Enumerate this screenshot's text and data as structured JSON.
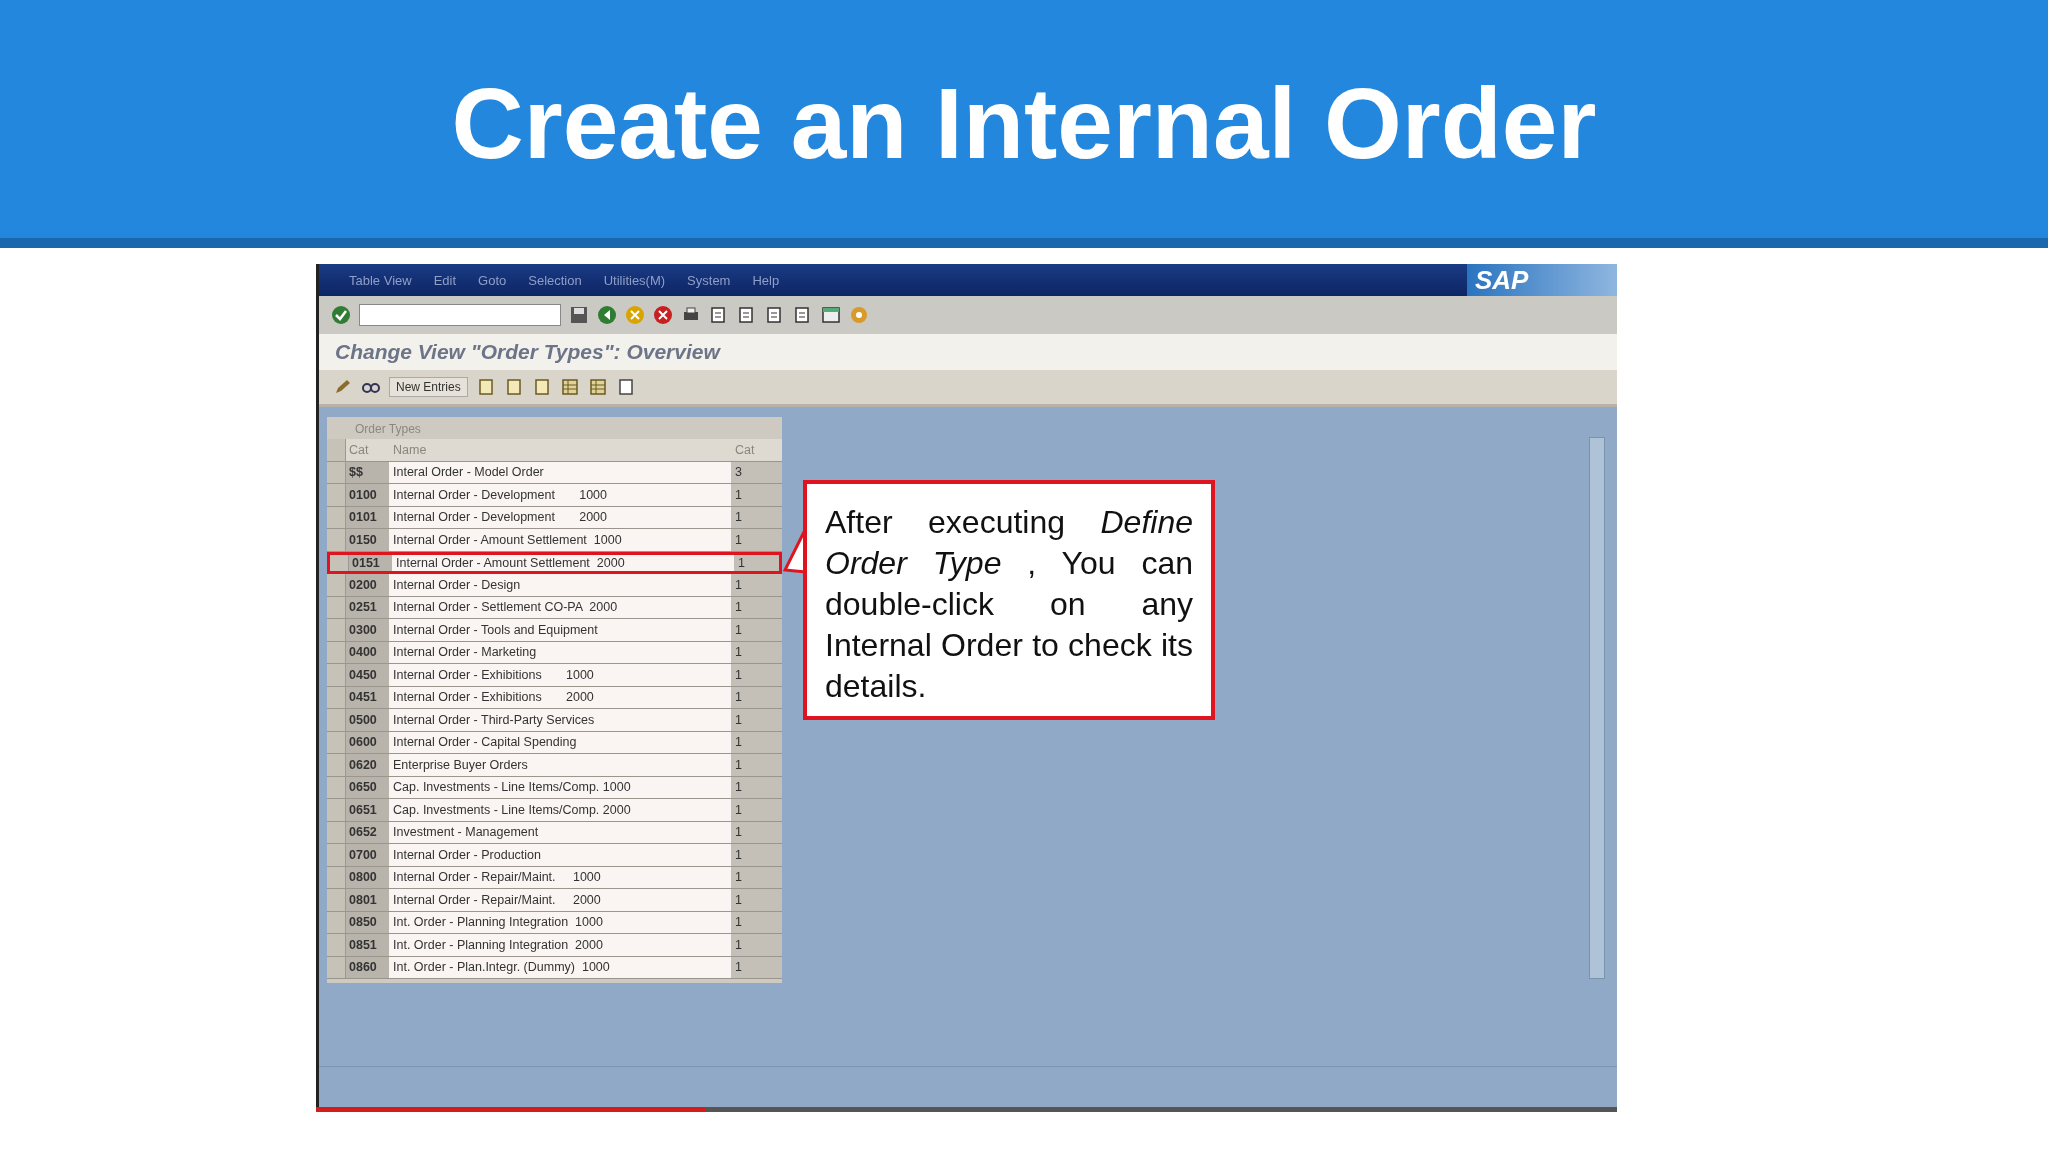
{
  "slide": {
    "title": "Create an Internal Order"
  },
  "sap_window": {
    "menu": [
      "Table View",
      "Edit",
      "Goto",
      "Selection",
      "Utilities(M)",
      "System",
      "Help"
    ],
    "logo": "SAP",
    "screen_title": "Change View \"Order Types\": Overview",
    "app_toolbar": {
      "new_entries": "New Entries"
    },
    "section_title": "Order Types",
    "table": {
      "columns": [
        "Cat",
        "Name",
        "Cat"
      ],
      "rows": [
        {
          "cat": "$$",
          "name": "Interal Order - Model Order",
          "cat2": "3",
          "highlighted": false
        },
        {
          "cat": "0100",
          "name": "Internal Order - Development       1000",
          "cat2": "1",
          "highlighted": false
        },
        {
          "cat": "0101",
          "name": "Internal Order - Development       2000",
          "cat2": "1",
          "highlighted": false
        },
        {
          "cat": "0150",
          "name": "Internal Order - Amount Settlement  1000",
          "cat2": "1",
          "highlighted": false
        },
        {
          "cat": "0151",
          "name": "Internal Order - Amount Settlement  2000",
          "cat2": "1",
          "highlighted": true
        },
        {
          "cat": "0200",
          "name": "Internal Order - Design",
          "cat2": "1",
          "highlighted": false
        },
        {
          "cat": "0251",
          "name": "Internal Order - Settlement CO-PA  2000",
          "cat2": "1",
          "highlighted": false
        },
        {
          "cat": "0300",
          "name": "Internal Order - Tools and Equipment",
          "cat2": "1",
          "highlighted": false
        },
        {
          "cat": "0400",
          "name": "Internal Order - Marketing",
          "cat2": "1",
          "highlighted": false
        },
        {
          "cat": "0450",
          "name": "Internal Order - Exhibitions       1000",
          "cat2": "1",
          "highlighted": false
        },
        {
          "cat": "0451",
          "name": "Internal Order - Exhibitions       2000",
          "cat2": "1",
          "highlighted": false
        },
        {
          "cat": "0500",
          "name": "Internal Order - Third-Party Services",
          "cat2": "1",
          "highlighted": false
        },
        {
          "cat": "0600",
          "name": "Internal Order - Capital Spending",
          "cat2": "1",
          "highlighted": false
        },
        {
          "cat": "0620",
          "name": "Enterprise Buyer Orders",
          "cat2": "1",
          "highlighted": false
        },
        {
          "cat": "0650",
          "name": "Cap. Investments - Line Items/Comp. 1000",
          "cat2": "1",
          "highlighted": false
        },
        {
          "cat": "0651",
          "name": "Cap. Investments - Line Items/Comp. 2000",
          "cat2": "1",
          "highlighted": false
        },
        {
          "cat": "0652",
          "name": "Investment - Management",
          "cat2": "1",
          "highlighted": false
        },
        {
          "cat": "0700",
          "name": "Internal Order - Production",
          "cat2": "1",
          "highlighted": false
        },
        {
          "cat": "0800",
          "name": "Internal Order - Repair/Maint.     1000",
          "cat2": "1",
          "highlighted": false
        },
        {
          "cat": "0801",
          "name": "Internal Order - Repair/Maint.     2000",
          "cat2": "1",
          "highlighted": false
        },
        {
          "cat": "0850",
          "name": "Int. Order - Planning Integration  1000",
          "cat2": "1",
          "highlighted": false
        },
        {
          "cat": "0851",
          "name": "Int. Order - Planning Integration  2000",
          "cat2": "1",
          "highlighted": false
        },
        {
          "cat": "0860",
          "name": "Int. Order - Plan.Integr. (Dummy)  1000",
          "cat2": "1",
          "highlighted": false
        }
      ]
    }
  },
  "callout": {
    "text": "After executing *Define Order Type* , You can double-click on any Internal Order to check its details."
  },
  "video_progress": {
    "level": 0.3
  }
}
